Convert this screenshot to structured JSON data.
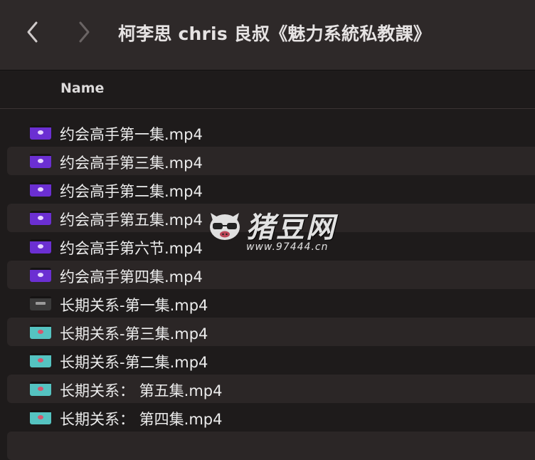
{
  "window": {
    "title": "柯李思 chris 良叔《魅力系統私教課》"
  },
  "columns": {
    "name": "Name"
  },
  "files": [
    {
      "name": "约会高手第一集.mp4",
      "icon": "purple-video-icon"
    },
    {
      "name": "约会高手第三集.mp4",
      "icon": "purple-video-icon"
    },
    {
      "name": "约会高手第二集.mp4",
      "icon": "purple-video-icon"
    },
    {
      "name": "约会高手第五集.mp4",
      "icon": "purple-video-icon"
    },
    {
      "name": "约会高手第六节.mp4",
      "icon": "purple-video-icon"
    },
    {
      "name": "约会高手第四集.mp4",
      "icon": "purple-video-icon"
    },
    {
      "name": "长期关系-第一集.mp4",
      "icon": "dark-video-icon"
    },
    {
      "name": "长期关系-第三集.mp4",
      "icon": "teal-video-icon"
    },
    {
      "name": "长期关系-第二集.mp4",
      "icon": "teal-video-icon"
    },
    {
      "name": "长期关系： 第五集.mp4",
      "icon": "teal-video-icon"
    },
    {
      "name": "长期关系： 第四集.mp4",
      "icon": "teal-video-icon"
    }
  ],
  "watermark": {
    "brand": "猪豆网",
    "url": "www.97444.cn"
  },
  "colors": {
    "toolbar": "#2e2929",
    "background": "#1e1b1b",
    "alt_row": "#2b2626",
    "purple_icon": "#6b2fd2",
    "teal_icon": "#55c3c1"
  }
}
